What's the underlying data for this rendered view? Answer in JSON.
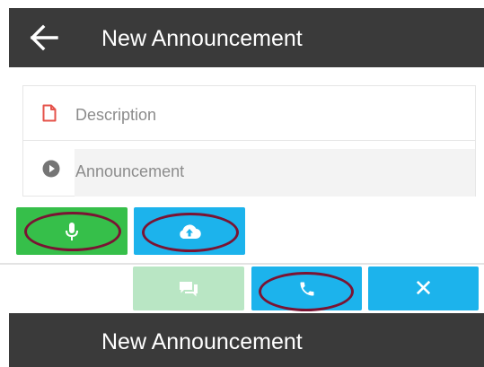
{
  "app_bar": {
    "title": "New Announcement",
    "back_icon": "arrow-left-icon",
    "background": "#3a3a3a"
  },
  "form": {
    "description": {
      "placeholder": "Description",
      "icon": "document-icon",
      "icon_color": "#e5534b"
    },
    "announcement": {
      "placeholder": "Announcement",
      "icon": "play-circle-icon"
    }
  },
  "actions": {
    "record": {
      "icon": "microphone-icon",
      "color": "#36bf4a"
    },
    "upload": {
      "icon": "cloud-upload-icon",
      "color": "#1cb3ec"
    },
    "message": {
      "icon": "chat-icon",
      "color": "#b9e6c4"
    },
    "call": {
      "icon": "phone-icon",
      "color": "#1cb3ec"
    },
    "close": {
      "glyph": "✕",
      "icon": "close-icon",
      "color": "#1cb3ec"
    }
  },
  "highlight_color": "#7a1433",
  "bottom_bar": {
    "title": "New Announcement"
  }
}
